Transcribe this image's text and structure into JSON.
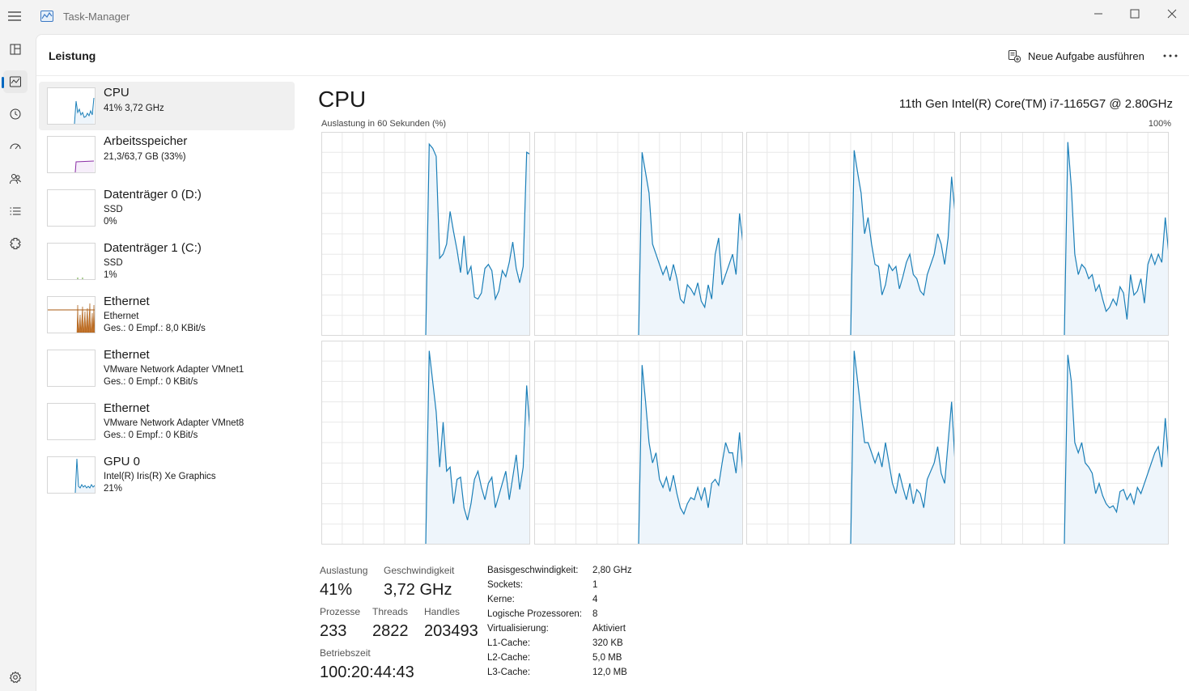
{
  "window": {
    "title": "Task-Manager"
  },
  "header": {
    "title": "Leistung",
    "run_task_label": "Neue Aufgabe ausführen"
  },
  "nav": {
    "items": [
      "processes-icon",
      "performance-icon",
      "history-icon",
      "startup-icon",
      "users-icon",
      "details-icon",
      "services-icon",
      "settings-icon"
    ]
  },
  "sidebar": {
    "items": [
      {
        "title": "CPU",
        "line1": "41% 3,72 GHz",
        "line2": ""
      },
      {
        "title": "Arbeitsspeicher",
        "line1": "21,3/63,7 GB (33%)",
        "line2": ""
      },
      {
        "title": "Datenträger 0 (D:)",
        "line1": "SSD",
        "line2": "0%"
      },
      {
        "title": "Datenträger 1 (C:)",
        "line1": "SSD",
        "line2": "1%"
      },
      {
        "title": "Ethernet",
        "line1": "Ethernet",
        "line2": "Ges.: 0 Empf.: 8,0 KBit/s"
      },
      {
        "title": "Ethernet",
        "line1": "VMware Network Adapter VMnet1",
        "line2": "Ges.: 0 Empf.: 0 KBit/s"
      },
      {
        "title": "Ethernet",
        "line1": "VMware Network Adapter VMnet8",
        "line2": "Ges.: 0 Empf.: 0 KBit/s"
      },
      {
        "title": "GPU 0",
        "line1": "Intel(R) Iris(R) Xe Graphics",
        "line2": "21%"
      }
    ]
  },
  "cpu": {
    "title": "CPU",
    "model": "11th Gen Intel(R) Core(TM) i7-1165G7 @ 2.80GHz",
    "graph_label": "Auslastung in 60 Sekunden (%)",
    "graph_max": "100%"
  },
  "stats": {
    "auslastung": {
      "label": "Auslastung",
      "value": "41%"
    },
    "geschwindigkeit": {
      "label": "Geschwindigkeit",
      "value": "3,72 GHz"
    },
    "prozesse": {
      "label": "Prozesse",
      "value": "233"
    },
    "threads": {
      "label": "Threads",
      "value": "2822"
    },
    "handles": {
      "label": "Handles",
      "value": "203493"
    },
    "betriebszeit": {
      "label": "Betriebszeit",
      "value": "100:20:44:43"
    }
  },
  "specs": [
    {
      "label": "Basisgeschwindigkeit:",
      "value": "2,80 GHz"
    },
    {
      "label": "Sockets:",
      "value": "1"
    },
    {
      "label": "Kerne:",
      "value": "4"
    },
    {
      "label": "Logische Prozessoren:",
      "value": "8"
    },
    {
      "label": "Virtualisierung:",
      "value": "Aktiviert"
    },
    {
      "label": "L1-Cache:",
      "value": "320 KB"
    },
    {
      "label": "L2-Cache:",
      "value": "5,0 MB"
    },
    {
      "label": "L3-Cache:",
      "value": "12,0 MB"
    }
  ],
  "colors": {
    "cpu_line": "#1b7fb8",
    "cpu_fill": "#eef5fb",
    "memory_line": "#8b2fa6",
    "ethernet_line": "#a85a10",
    "grid": "#e8e8e8",
    "accent": "#0067c0"
  },
  "chart_data": {
    "type": "line",
    "title": "Auslastung in 60 Sekunden (%)",
    "ylim": [
      0,
      100
    ],
    "series": [
      {
        "values": [
          0,
          0,
          0,
          0,
          0,
          0,
          0,
          0,
          0,
          0,
          0,
          0,
          0,
          0,
          0,
          0,
          0,
          0,
          0,
          0,
          0,
          0,
          0,
          0,
          0,
          0,
          0,
          0,
          0,
          0,
          0,
          94,
          92,
          88,
          38,
          40,
          45,
          61,
          51,
          42,
          31,
          49,
          30,
          34,
          19,
          18,
          21,
          33,
          35,
          32,
          18,
          22,
          32,
          29,
          36,
          46,
          33,
          26,
          34,
          90,
          89
        ]
      },
      {
        "values": [
          0,
          0,
          0,
          0,
          0,
          0,
          0,
          0,
          0,
          0,
          0,
          0,
          0,
          0,
          0,
          0,
          0,
          0,
          0,
          0,
          0,
          0,
          0,
          0,
          0,
          0,
          0,
          0,
          0,
          0,
          0,
          90,
          80,
          70,
          45,
          40,
          35,
          30,
          34,
          27,
          35,
          28,
          18,
          16,
          25,
          23,
          20,
          26,
          17,
          14,
          25,
          18,
          40,
          48,
          25,
          30,
          35,
          40,
          30,
          60,
          45
        ]
      },
      {
        "values": [
          0,
          0,
          0,
          0,
          0,
          0,
          0,
          0,
          0,
          0,
          0,
          0,
          0,
          0,
          0,
          0,
          0,
          0,
          0,
          0,
          0,
          0,
          0,
          0,
          0,
          0,
          0,
          0,
          0,
          0,
          0,
          91,
          80,
          70,
          50,
          58,
          45,
          35,
          34,
          20,
          25,
          35,
          32,
          34,
          23,
          29,
          36,
          40,
          30,
          28,
          22,
          20,
          30,
          35,
          40,
          50,
          45,
          35,
          48,
          78,
          60
        ]
      },
      {
        "values": [
          0,
          0,
          0,
          0,
          0,
          0,
          0,
          0,
          0,
          0,
          0,
          0,
          0,
          0,
          0,
          0,
          0,
          0,
          0,
          0,
          0,
          0,
          0,
          0,
          0,
          0,
          0,
          0,
          0,
          0,
          0,
          95,
          73,
          40,
          30,
          35,
          33,
          28,
          30,
          22,
          25,
          18,
          12,
          14,
          18,
          15,
          24,
          21,
          8,
          30,
          20,
          22,
          28,
          16,
          35,
          40,
          35,
          40,
          36,
          58,
          40
        ]
      },
      {
        "values": [
          0,
          0,
          0,
          0,
          0,
          0,
          0,
          0,
          0,
          0,
          0,
          0,
          0,
          0,
          0,
          0,
          0,
          0,
          0,
          0,
          0,
          0,
          0,
          0,
          0,
          0,
          0,
          0,
          0,
          0,
          0,
          95,
          80,
          65,
          38,
          60,
          36,
          38,
          20,
          32,
          33,
          18,
          12,
          20,
          32,
          36,
          28,
          22,
          30,
          33,
          18,
          24,
          30,
          36,
          22,
          33,
          44,
          27,
          38,
          78,
          55
        ]
      },
      {
        "values": [
          0,
          0,
          0,
          0,
          0,
          0,
          0,
          0,
          0,
          0,
          0,
          0,
          0,
          0,
          0,
          0,
          0,
          0,
          0,
          0,
          0,
          0,
          0,
          0,
          0,
          0,
          0,
          0,
          0,
          0,
          0,
          88,
          70,
          50,
          40,
          45,
          32,
          28,
          33,
          26,
          34,
          25,
          18,
          15,
          20,
          23,
          22,
          28,
          22,
          28,
          18,
          30,
          32,
          29,
          40,
          50,
          45,
          45,
          35,
          55,
          35
        ]
      },
      {
        "values": [
          0,
          0,
          0,
          0,
          0,
          0,
          0,
          0,
          0,
          0,
          0,
          0,
          0,
          0,
          0,
          0,
          0,
          0,
          0,
          0,
          0,
          0,
          0,
          0,
          0,
          0,
          0,
          0,
          0,
          0,
          0,
          95,
          80,
          65,
          50,
          50,
          45,
          40,
          45,
          38,
          50,
          40,
          30,
          25,
          35,
          28,
          22,
          30,
          20,
          27,
          25,
          18,
          32,
          36,
          40,
          48,
          35,
          30,
          50,
          70,
          40
        ]
      },
      {
        "values": [
          0,
          0,
          0,
          0,
          0,
          0,
          0,
          0,
          0,
          0,
          0,
          0,
          0,
          0,
          0,
          0,
          0,
          0,
          0,
          0,
          0,
          0,
          0,
          0,
          0,
          0,
          0,
          0,
          0,
          0,
          0,
          93,
          80,
          50,
          45,
          50,
          40,
          38,
          35,
          25,
          30,
          24,
          20,
          18,
          19,
          16,
          26,
          27,
          22,
          25,
          20,
          28,
          25,
          30,
          35,
          40,
          45,
          48,
          38,
          62,
          40
        ]
      }
    ]
  }
}
